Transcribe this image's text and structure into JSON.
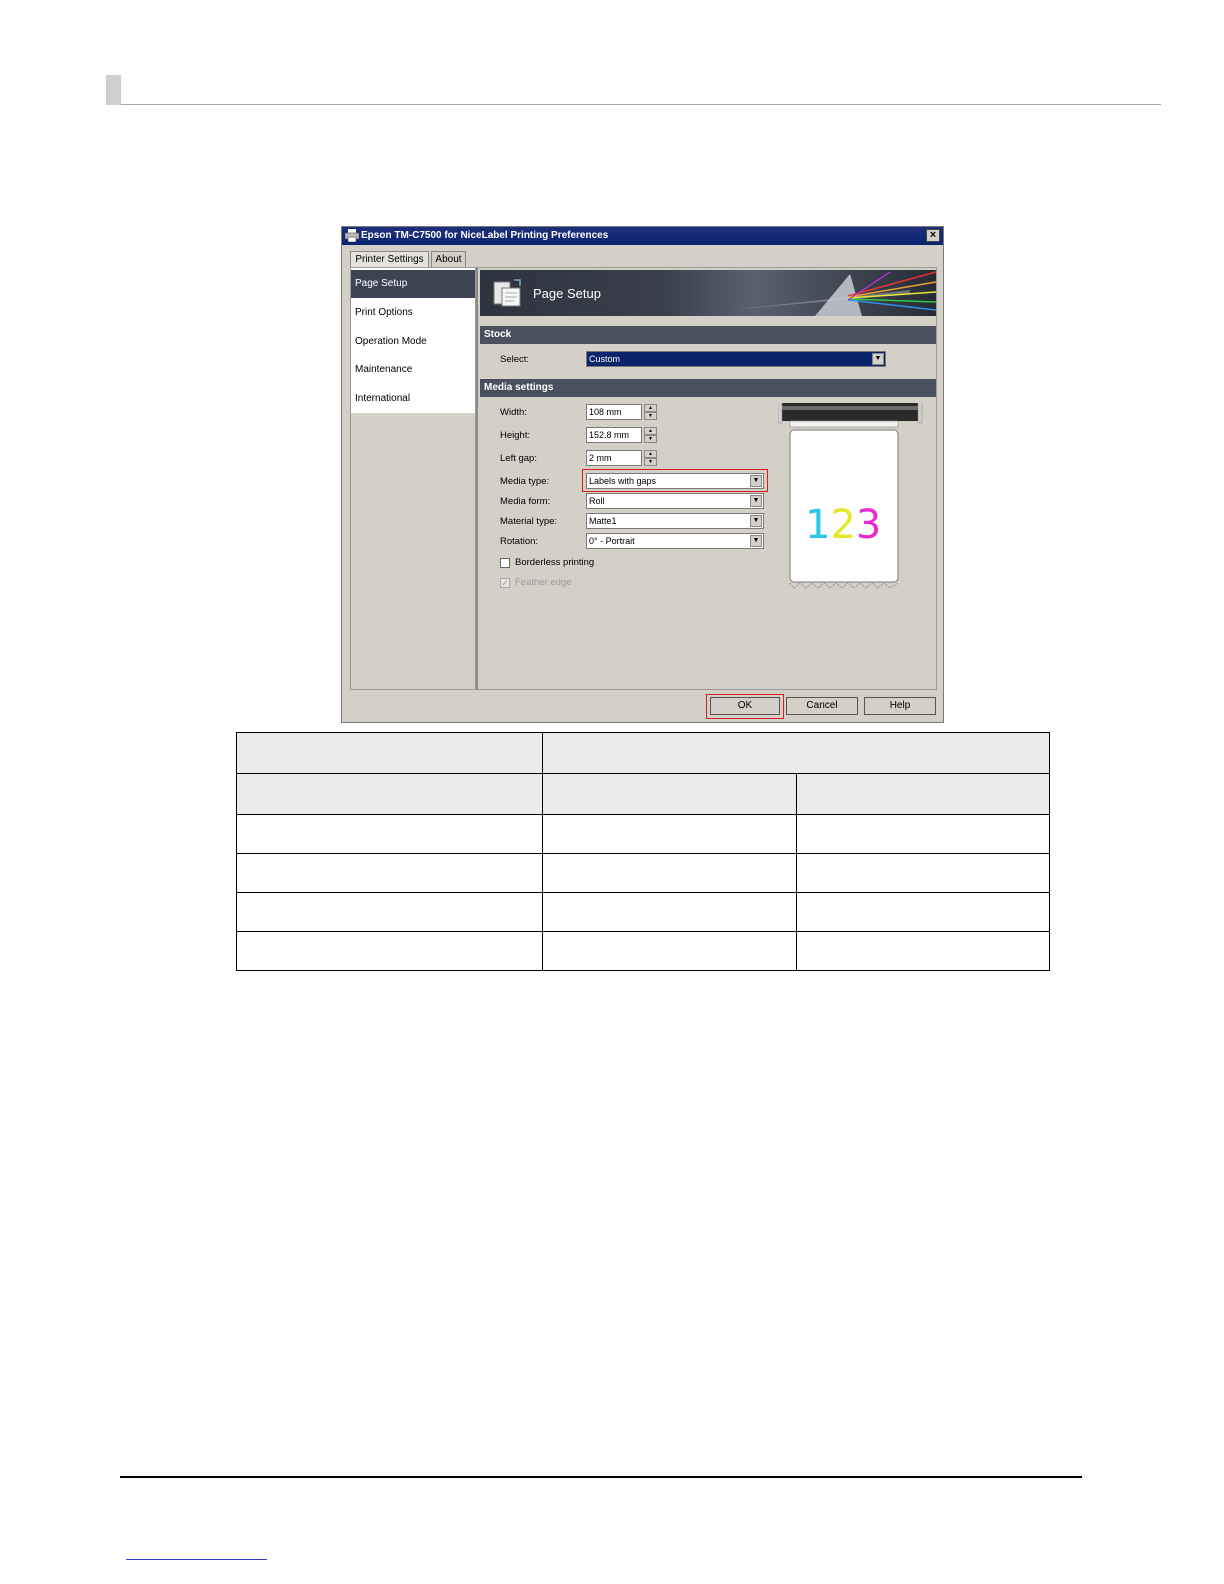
{
  "dialog": {
    "title": "Epson TM-C7500 for NiceLabel Printing Preferences",
    "close_glyph": "×",
    "tabs": [
      {
        "label": "Printer Settings"
      },
      {
        "label": "About"
      }
    ],
    "sidebar": {
      "items": [
        {
          "label": "Page Setup"
        },
        {
          "label": "Print Options"
        },
        {
          "label": "Operation Mode"
        },
        {
          "label": "Maintenance"
        },
        {
          "label": "International"
        }
      ]
    },
    "banner": {
      "title": "Page Setup"
    },
    "stock": {
      "header": "Stock",
      "select_label": "Select:",
      "select_value": "Custom"
    },
    "media": {
      "header": "Media settings",
      "width_label": "Width:",
      "width_value": "108 mm",
      "height_label": "Height:",
      "height_value": "152.8 mm",
      "leftgap_label": "Left gap:",
      "leftgap_value": "2 mm",
      "mediatype_label": "Media type:",
      "mediatype_value": "Labels with gaps",
      "mediaform_label": "Media form:",
      "mediaform_value": "Roll",
      "material_label": "Material type:",
      "material_value": "Matte1",
      "rotation_label": "Rotation:",
      "rotation_value": "0° - Portrait",
      "borderless_label": "Borderless printing",
      "feather_label": "Feather edge",
      "borderless_checked": false,
      "feather_checked": true
    },
    "preview": {
      "digits": [
        "1",
        "2",
        "3"
      ],
      "colors": [
        "#29c6e8",
        "#e6e62a",
        "#e82ad2"
      ]
    },
    "buttons": {
      "ok": "OK",
      "cancel": "Cancel",
      "help": "Help"
    }
  },
  "table": {
    "rows": [
      [
        "",
        ""
      ],
      [
        "",
        "",
        ""
      ],
      [
        "",
        "",
        ""
      ],
      [
        "",
        "",
        ""
      ],
      [
        "",
        "",
        ""
      ],
      [
        "",
        "",
        ""
      ]
    ]
  },
  "colors": {
    "highlight_box": "#d02020",
    "selection": "#0a246a",
    "titlebar": "#0a2470"
  }
}
